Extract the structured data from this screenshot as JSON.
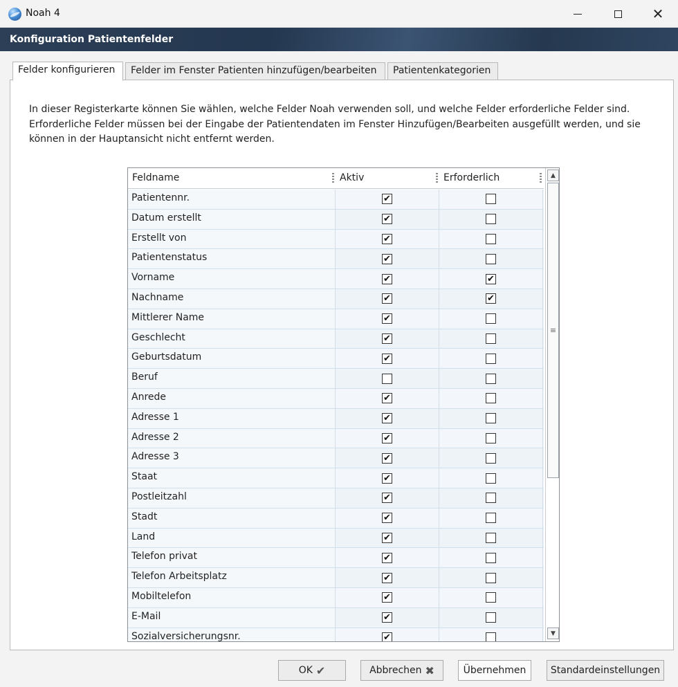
{
  "window": {
    "title": "Noah 4",
    "minimize_icon": "minimize-icon",
    "maximize_icon": "maximize-icon",
    "close_glyph": "✕"
  },
  "header": {
    "title": "Konfiguration Patientenfelder"
  },
  "tabs": [
    {
      "label": "Felder konfigurieren",
      "active": true
    },
    {
      "label": "Felder im Fenster Patienten hinzufügen/bearbeiten",
      "active": false
    },
    {
      "label": "Patientenkategorien",
      "active": false
    }
  ],
  "description": "In dieser Registerkarte können Sie wählen, welche Felder Noah verwenden soll, und welche Felder erforderliche Felder sind. Erforderliche Felder müssen bei der Eingabe der Patientendaten im Fenster Hinzufügen/Bearbeiten ausgefüllt werden, und sie können in der Hauptansicht nicht entfernt werden.",
  "grid": {
    "columns": {
      "name": "Feldname",
      "active": "Aktiv",
      "required": "Erforderlich"
    },
    "rows": [
      {
        "name": "Patientennr.",
        "active": true,
        "required": false
      },
      {
        "name": "Datum erstellt",
        "active": true,
        "required": false
      },
      {
        "name": "Erstellt von",
        "active": true,
        "required": false
      },
      {
        "name": "Patientenstatus",
        "active": true,
        "required": false
      },
      {
        "name": "Vorname",
        "active": true,
        "required": true
      },
      {
        "name": "Nachname",
        "active": true,
        "required": true
      },
      {
        "name": "Mittlerer Name",
        "active": true,
        "required": false
      },
      {
        "name": "Geschlecht",
        "active": true,
        "required": false
      },
      {
        "name": "Geburtsdatum",
        "active": true,
        "required": false
      },
      {
        "name": "Beruf",
        "active": false,
        "required": false
      },
      {
        "name": "Anrede",
        "active": true,
        "required": false
      },
      {
        "name": "Adresse 1",
        "active": true,
        "required": false
      },
      {
        "name": "Adresse 2",
        "active": true,
        "required": false
      },
      {
        "name": "Adresse 3",
        "active": true,
        "required": false
      },
      {
        "name": "Staat",
        "active": true,
        "required": false
      },
      {
        "name": "Postleitzahl",
        "active": true,
        "required": false
      },
      {
        "name": "Stadt",
        "active": true,
        "required": false
      },
      {
        "name": "Land",
        "active": true,
        "required": false
      },
      {
        "name": "Telefon privat",
        "active": true,
        "required": false
      },
      {
        "name": "Telefon Arbeitsplatz",
        "active": true,
        "required": false
      },
      {
        "name": "Mobiltelefon",
        "active": true,
        "required": false
      },
      {
        "name": "E-Mail",
        "active": true,
        "required": false
      },
      {
        "name": "Sozialversicherungsnr.",
        "active": true,
        "required": false
      }
    ],
    "scrollbar": {
      "up_glyph": "▲",
      "down_glyph": "▼",
      "thumb_glyph": "≡"
    }
  },
  "buttons": {
    "ok": {
      "label": "OK",
      "icon": "checkmark-icon",
      "glyph": "✔"
    },
    "cancel": {
      "label": "Abbrechen",
      "icon": "cross-icon",
      "glyph": "✖"
    },
    "apply": {
      "label": "Übernehmen"
    },
    "defaults": {
      "label": "Standardeinstellungen"
    }
  },
  "check_glyph": "✔"
}
